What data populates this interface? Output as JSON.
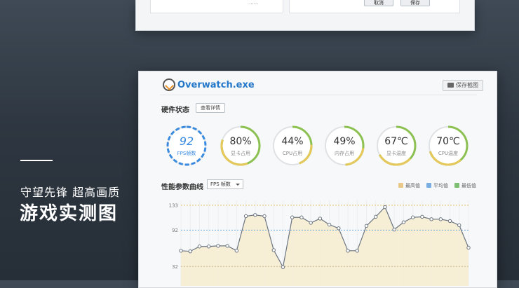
{
  "top_window": {
    "cancel_label": "取消",
    "save_label": "保存",
    "fragment_text": "......"
  },
  "caption": {
    "subtitle": "守望先锋 超高画质",
    "title": "游戏实测图"
  },
  "app": {
    "title": "Overwatch.exe",
    "screenshot_button": "保存截图"
  },
  "hardware": {
    "title": "硬件状态",
    "detail_button": "查看详情",
    "gauges": [
      {
        "value": "92",
        "label": "FPS帧数",
        "percent": 92,
        "color": "#3a8be0",
        "kind": "fps"
      },
      {
        "value": "80%",
        "label": "显卡占用",
        "percent": 80,
        "color": "#8cc152"
      },
      {
        "value": "44%",
        "label": "CPU占用",
        "percent": 44,
        "color": "#8cc152"
      },
      {
        "value": "49%",
        "label": "内存占用",
        "percent": 49,
        "color": "#8cc152"
      },
      {
        "value": "67℃",
        "label": "显卡温度",
        "percent": 67,
        "color": "#8cc152"
      },
      {
        "value": "70℃",
        "label": "CPU温度",
        "percent": 70,
        "color": "#8cc152"
      }
    ]
  },
  "performance": {
    "title": "性能参数曲线",
    "selected_metric": "FPS 帧数",
    "legend": [
      {
        "label": "最高值",
        "color": "#e8c98a"
      },
      {
        "label": "平均值",
        "color": "#7aaee0"
      },
      {
        "label": "最低值",
        "color": "#7dbf72"
      }
    ]
  },
  "chart_data": {
    "type": "line",
    "y_ticks": [
      133,
      92,
      32
    ],
    "ylim": [
      0,
      141
    ],
    "reference_lines": {
      "max": 133,
      "avg": 92,
      "min": 32
    },
    "values": [
      58,
      57,
      65,
      65,
      66,
      66,
      58,
      115,
      117,
      115,
      59,
      31,
      113,
      113,
      104,
      111,
      101,
      95,
      58,
      58,
      99,
      114,
      130,
      93,
      105,
      113,
      114,
      110,
      110,
      107,
      100,
      63
    ]
  }
}
